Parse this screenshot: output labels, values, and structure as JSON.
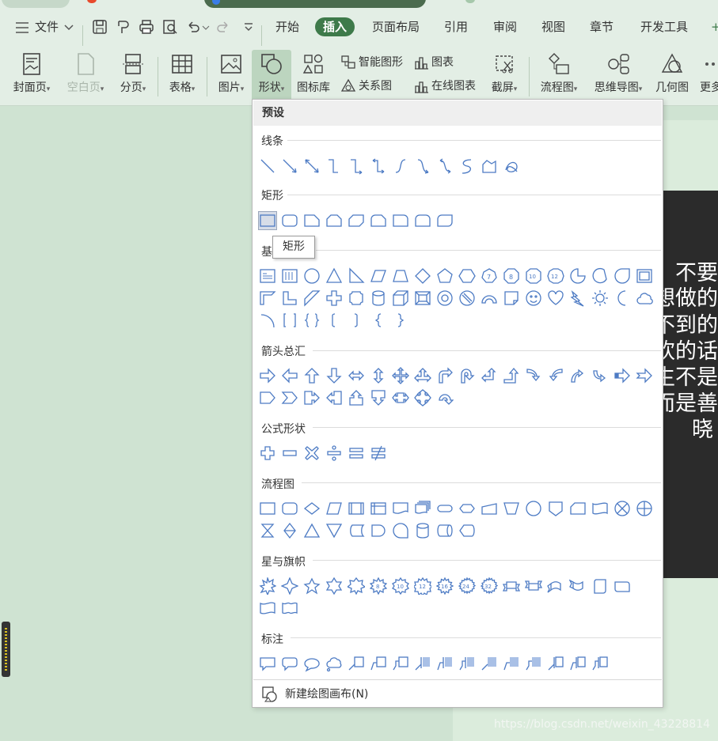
{
  "menubar": {
    "file_label": "文件",
    "tabs": [
      "开始",
      "插入",
      "页面布局",
      "引用",
      "审阅",
      "视图",
      "章节",
      "开发工具"
    ],
    "active_tab": "插入"
  },
  "ribbon": {
    "cover_page": "封面页",
    "blank_page": "空白页",
    "page_break": "分页",
    "table": "表格",
    "picture": "图片",
    "shape": "形状",
    "icon_library": "图标库",
    "smart_art": "智能图形",
    "chart": "图表",
    "relation": "关系图",
    "online_chart": "在线图表",
    "screenshot": "截屏",
    "flowchart": "流程图",
    "mindmap": "思维导图",
    "geometry": "几何图",
    "more": "更多"
  },
  "dropdown": {
    "header": "预设",
    "sections": {
      "lines": "线条",
      "rect": "矩形",
      "basic": "基",
      "arrows": "箭头总汇",
      "formula": "公式形状",
      "flow": "流程图",
      "stars": "星与旗帜",
      "callouts": "标注"
    },
    "tooltip": "矩形",
    "footer": "新建绘图画布(N)"
  },
  "slide_lines": [
    "不要",
    "想做的",
    "不到的",
    "欢的话",
    "生不是",
    "而是善",
    "晓"
  ],
  "watermark": "https://blog.csdn.net/weixin_43228814",
  "colors": {
    "accent": "#3e7a4a",
    "shape_stroke": "#4d7bc4",
    "background": "#cfe3d2"
  }
}
